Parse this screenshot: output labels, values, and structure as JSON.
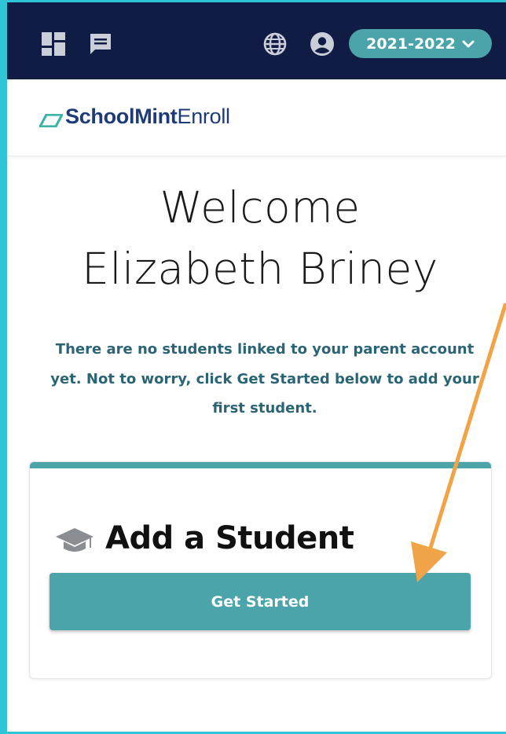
{
  "header": {
    "year_selector": {
      "label": "2021-2022"
    },
    "icons": [
      "dashboard-icon",
      "chat-icon",
      "globe-icon",
      "account-icon",
      "chevron-down-icon"
    ]
  },
  "brand": {
    "name_bold": "SchoolMint",
    "name_light": "Enroll"
  },
  "welcome": {
    "line1": "Welcome",
    "line2": "Elizabeth Briney"
  },
  "notice": {
    "line1": "There are no students linked to your parent account",
    "line2": "yet. Not to worry, click Get Started below to add your",
    "line3": "first student."
  },
  "card": {
    "title": "Add a Student",
    "icon": "graduation-cap-icon",
    "button_label": "Get Started"
  },
  "colors": {
    "header_bg": "#101c43",
    "accent_teal": "#4ba4a9",
    "frame_cyan": "#2fc4d6",
    "annotation_arrow": "#f0a347",
    "brand_navy": "#1d3b78",
    "notice_text": "#2a6475"
  }
}
